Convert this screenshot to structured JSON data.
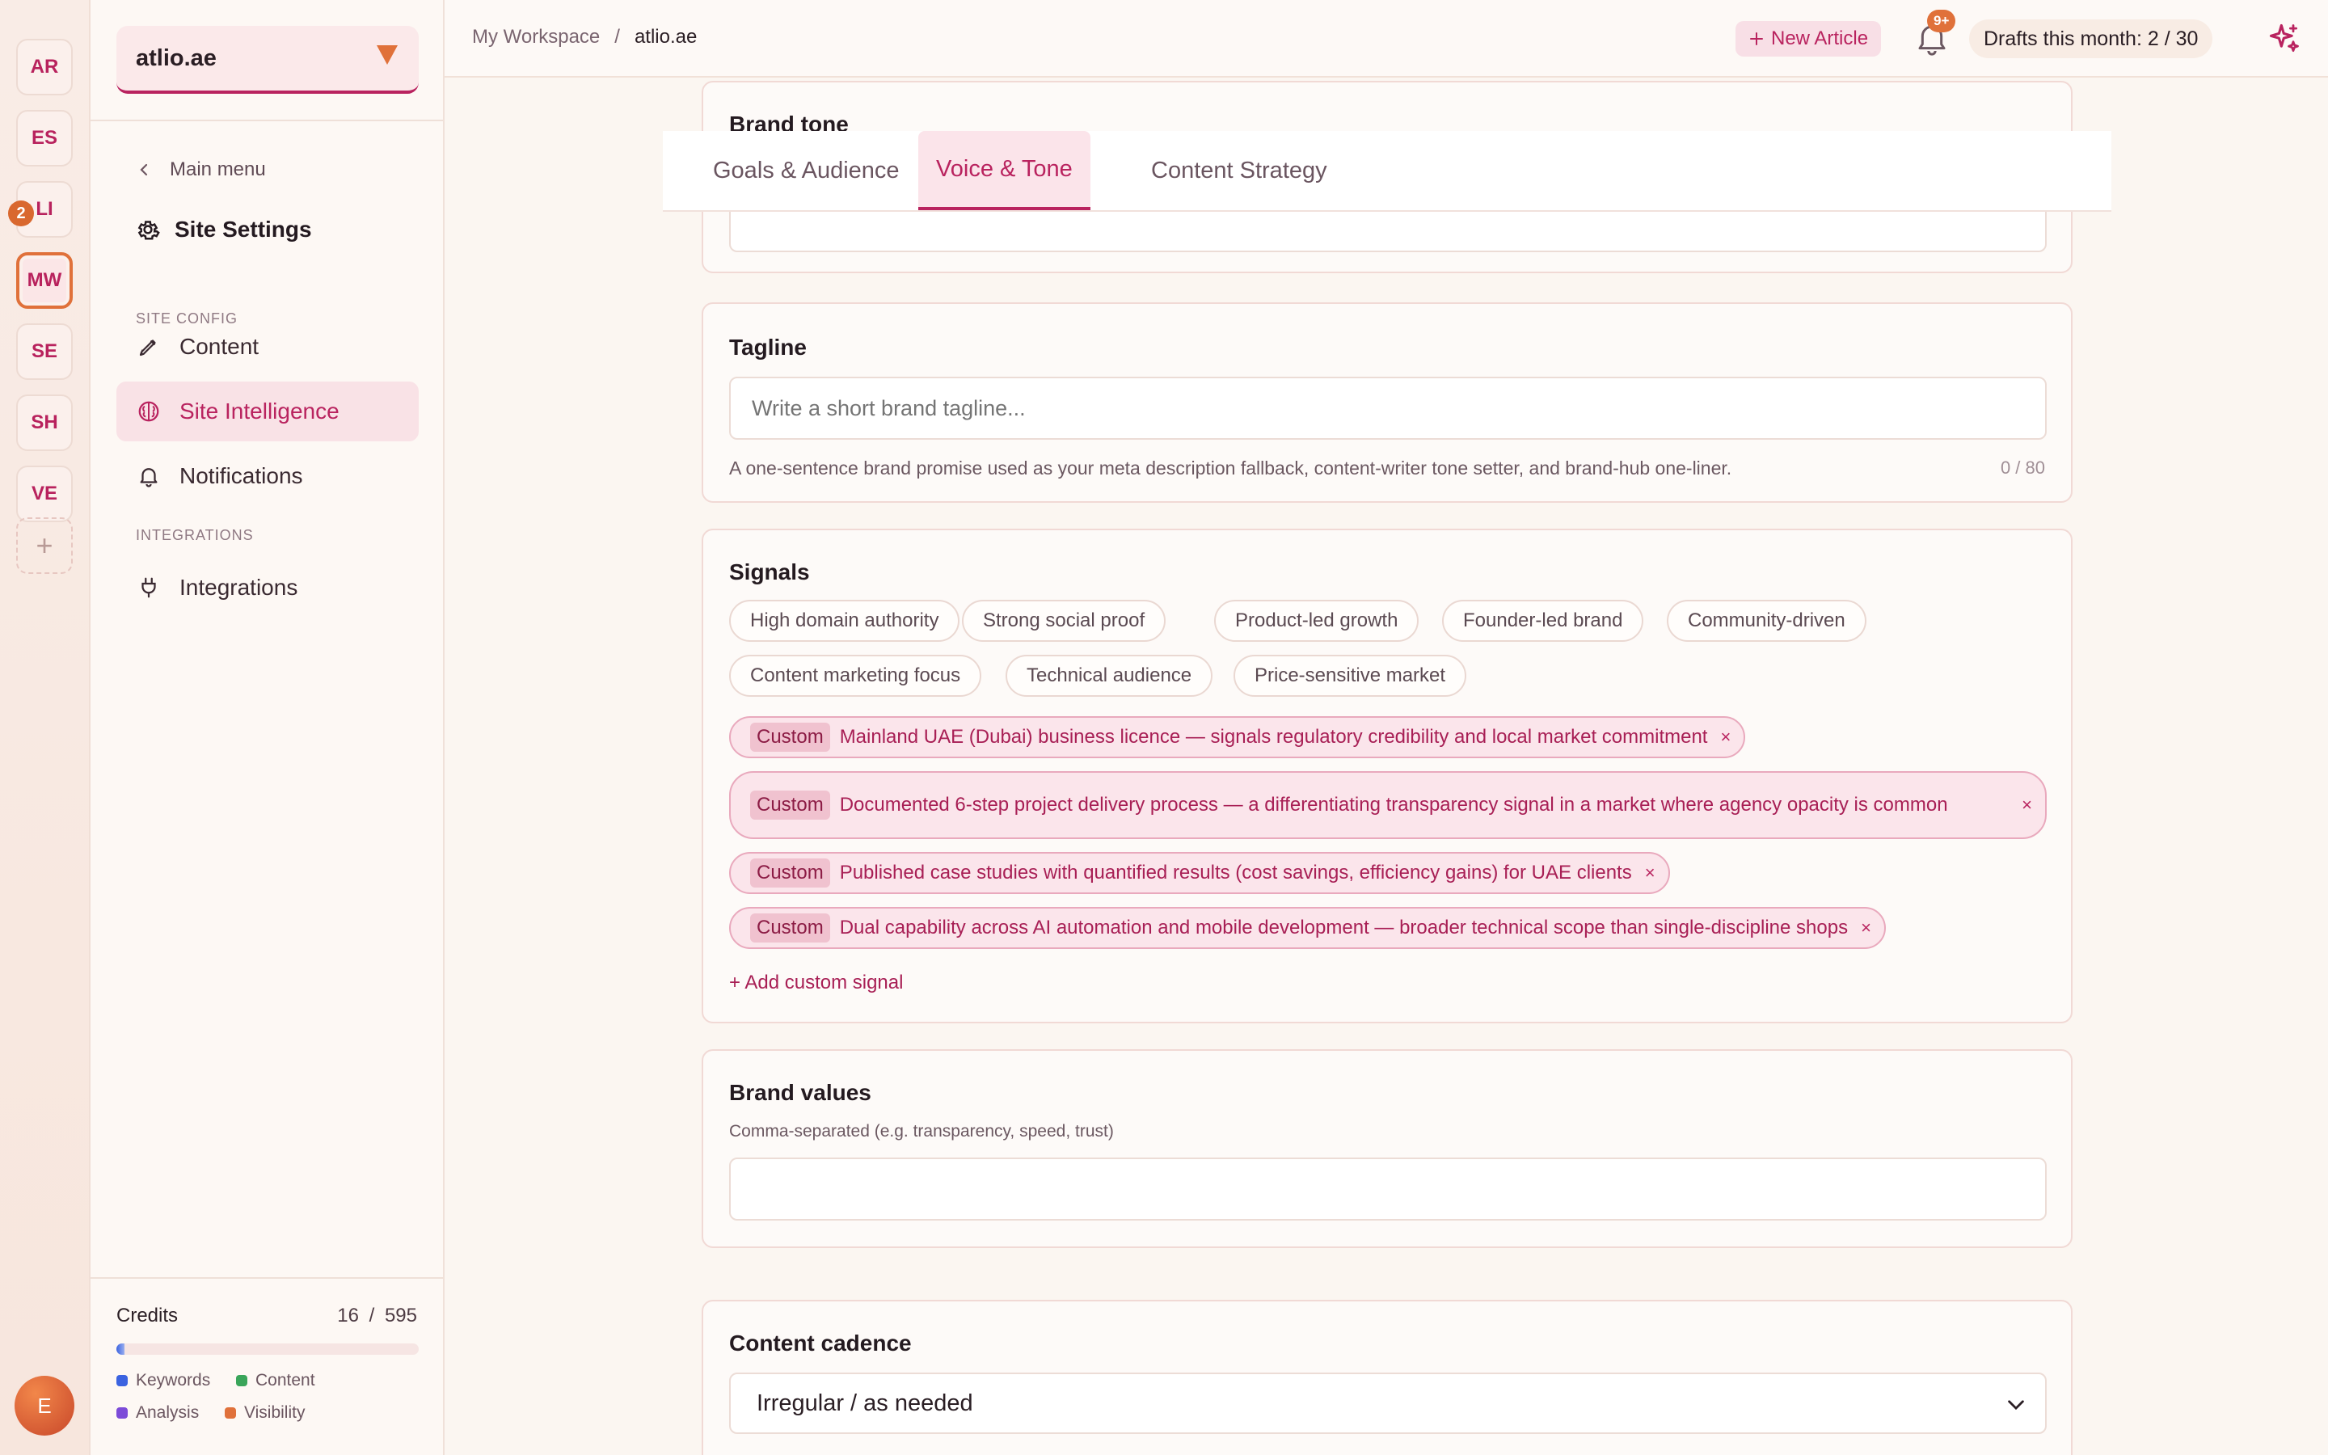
{
  "workspaces": [
    {
      "initials": "AR",
      "active": false
    },
    {
      "initials": "ES",
      "active": false
    },
    {
      "initials": "LI",
      "active": false
    },
    {
      "initials": "MW",
      "active": true
    },
    {
      "initials": "SE",
      "active": false
    },
    {
      "initials": "SH",
      "active": false
    },
    {
      "initials": "VE",
      "active": false
    }
  ],
  "workspace_badge": "2",
  "user_initial": "E",
  "sidebar": {
    "site_name": "atlio.ae",
    "back_label": "Main menu",
    "title": "Site Settings",
    "section_site_config": "SITE CONFIG",
    "section_integrations": "INTEGRATIONS",
    "items": {
      "content": "Content",
      "site_intelligence": "Site Intelligence",
      "notifications": "Notifications",
      "integrations": "Integrations"
    },
    "credits": {
      "label": "Credits",
      "used": "16",
      "sep": "/",
      "total": "595",
      "fraction_used": 0.027,
      "legend": {
        "keywords": "Keywords",
        "content": "Content",
        "analysis": "Analysis",
        "visibility": "Visibility"
      }
    }
  },
  "topbar": {
    "breadcrumb_root": "My Workspace",
    "breadcrumb_sep": "/",
    "breadcrumb_current": "atlio.ae",
    "new_article": "New Article",
    "notif_badge": "9+",
    "drafts": "Drafts this month: 2 / 30"
  },
  "tabs": {
    "goals": "Goals & Audience",
    "voice": "Voice & Tone",
    "strategy": "Content Strategy"
  },
  "brand_tone": {
    "title": "Brand tone"
  },
  "tagline": {
    "title": "Tagline",
    "placeholder": "Write a short brand tagline...",
    "hint": "A one-sentence brand promise used as your meta description fallback, content-writer tone setter, and brand-hub one-liner.",
    "counter": "0 / 80"
  },
  "signals": {
    "title": "Signals",
    "presets": [
      "High domain authority",
      "Strong social proof",
      "Product-led growth",
      "Founder-led brand",
      "Community-driven",
      "Content marketing focus",
      "Technical audience",
      "Price-sensitive market"
    ],
    "custom_tag": "Custom",
    "remove_glyph": "×",
    "custom": [
      "Mainland UAE (Dubai) business licence — signals regulatory credibility and local market commitment",
      "Documented 6-step project delivery process — a differentiating transparency signal in a market where agency opacity is common",
      "Published case studies with quantified results (cost savings, efficiency gains) for UAE clients",
      "Dual capability across AI automation and mobile development — broader technical scope than single-discipline shops"
    ],
    "add_label": "+ Add custom signal"
  },
  "brand_values": {
    "title": "Brand values",
    "hint": "Comma-separated (e.g. transparency, speed, trust)",
    "value": ""
  },
  "content_cadence": {
    "title": "Content cadence",
    "selected": "Irregular / as needed"
  },
  "colors": {
    "accent": "#b9235f",
    "orange": "#e0713a",
    "keywords": "#3b63e0",
    "content": "#3aa55a",
    "analysis": "#7c4bd8",
    "visibility": "#e0713a"
  }
}
